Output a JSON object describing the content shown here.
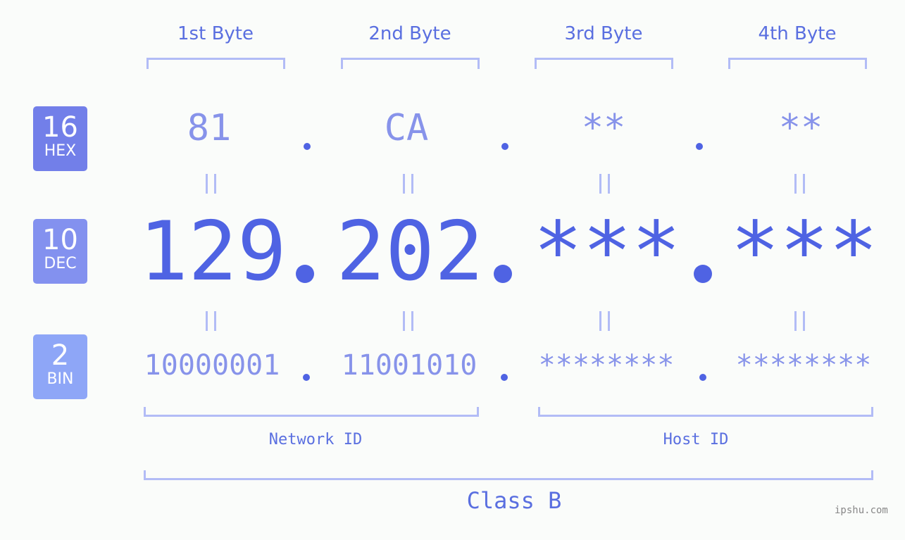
{
  "badges": [
    {
      "base": "16",
      "label": "HEX",
      "color": "#727fe9"
    },
    {
      "base": "10",
      "label": "DEC",
      "color": "#8391ef"
    },
    {
      "base": "2",
      "label": "BIN",
      "color": "#8ea6f7"
    }
  ],
  "byte_headers": [
    "1st Byte",
    "2nd Byte",
    "3rd Byte",
    "4th Byte"
  ],
  "hex": [
    "81",
    "CA",
    "**",
    "**"
  ],
  "dec": [
    "129",
    "202",
    "***",
    "***"
  ],
  "bin": [
    "10000001",
    "11001010",
    "********",
    "********"
  ],
  "separator": ".",
  "network_label": "Network ID",
  "host_label": "Host ID",
  "class_label": "Class B",
  "watermark": "ipshu.com",
  "colors": {
    "accent": "#4f63e3",
    "light": "#8793ea",
    "bracket": "#b2bcf6"
  }
}
